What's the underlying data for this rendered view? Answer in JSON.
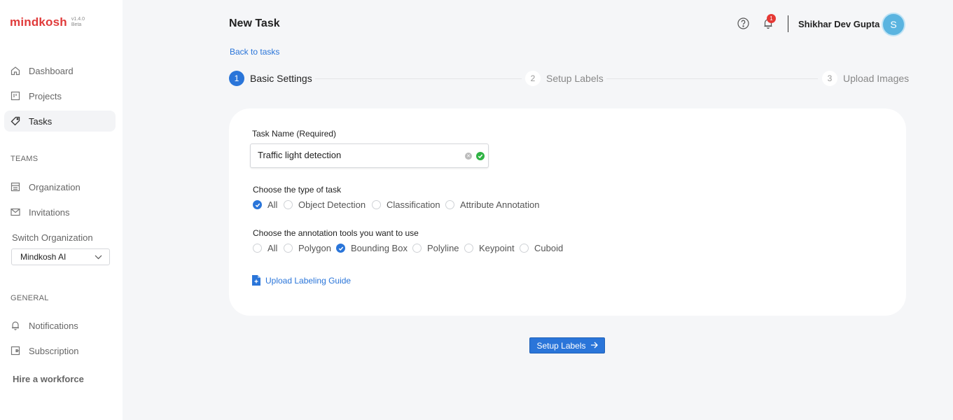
{
  "app": {
    "logo_text": "mindkosh",
    "version": "v1.4.0",
    "version_tag": "Beta"
  },
  "sidebar": {
    "items": [
      {
        "label": "Dashboard",
        "icon": "home-icon"
      },
      {
        "label": "Projects",
        "icon": "projects-icon"
      },
      {
        "label": "Tasks",
        "icon": "tag-icon",
        "active": true
      }
    ],
    "teams_title": "TEAMS",
    "team_items": [
      {
        "label": "Organization",
        "icon": "building-icon"
      },
      {
        "label": "Invitations",
        "icon": "mail-icon"
      }
    ],
    "switch_org_label": "Switch Organization",
    "org_selected": "Mindkosh AI",
    "general_title": "GENERAL",
    "general_items": [
      {
        "label": "Notifications",
        "icon": "bell-icon"
      },
      {
        "label": "Subscription",
        "icon": "subscription-icon"
      }
    ],
    "hire_label": "Hire a workforce"
  },
  "header": {
    "title": "New Task",
    "notification_count": "1",
    "user_name": "Shikhar Dev Gupta",
    "avatar_initial": "S"
  },
  "back_link": "Back to tasks",
  "steps": [
    {
      "num": "1",
      "label": "Basic Settings",
      "active": true
    },
    {
      "num": "2",
      "label": "Setup Labels",
      "active": false
    },
    {
      "num": "3",
      "label": "Upload Images",
      "active": false
    }
  ],
  "form": {
    "task_name_label": "Task Name (Required)",
    "task_name_value": "Traffic light detection",
    "task_type_label": "Choose the type of task",
    "task_types": [
      {
        "label": "All",
        "checked": true
      },
      {
        "label": "Object Detection",
        "checked": false
      },
      {
        "label": "Classification",
        "checked": false
      },
      {
        "label": "Attribute Annotation",
        "checked": false
      }
    ],
    "tools_label": "Choose the annotation tools you want to use",
    "tools": [
      {
        "label": "All",
        "checked": false
      },
      {
        "label": "Polygon",
        "checked": false
      },
      {
        "label": "Bounding Box",
        "checked": true
      },
      {
        "label": "Polyline",
        "checked": false
      },
      {
        "label": "Keypoint",
        "checked": false
      },
      {
        "label": "Cuboid",
        "checked": false
      }
    ],
    "upload_guide_label": "Upload Labeling Guide"
  },
  "next_button": "Setup Labels",
  "colors": {
    "accent": "#2a75d9",
    "brand": "#e03a3a",
    "success": "#2fb344",
    "badge": "#e53935"
  }
}
